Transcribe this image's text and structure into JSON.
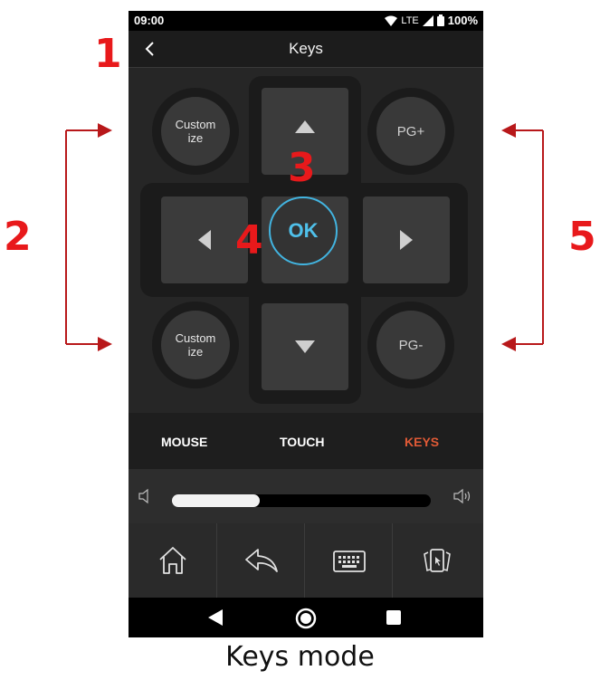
{
  "status_bar": {
    "time": "09:00",
    "network": "LTE",
    "battery": "100%"
  },
  "header": {
    "title": "Keys"
  },
  "pad": {
    "customize_top_label": "Custom\nize",
    "customize_bottom_label": "Custom\nize",
    "pg_up_label": "PG+",
    "pg_down_label": "PG-",
    "ok_label": "OK"
  },
  "modes": {
    "mouse": "MOUSE",
    "touch": "TOUCH",
    "keys": "KEYS",
    "active": "keys",
    "active_color": "#e05a36"
  },
  "volume": {
    "level_fraction": 0.34
  },
  "nav_icons": [
    "home-icon",
    "back-arrow-icon",
    "keyboard-icon",
    "app-switch-icon"
  ],
  "annotations": {
    "m1": "1",
    "m2": "2",
    "m3": "3",
    "m4": "4",
    "m5": "5",
    "color": "#e8191b"
  },
  "caption": "Keys mode"
}
